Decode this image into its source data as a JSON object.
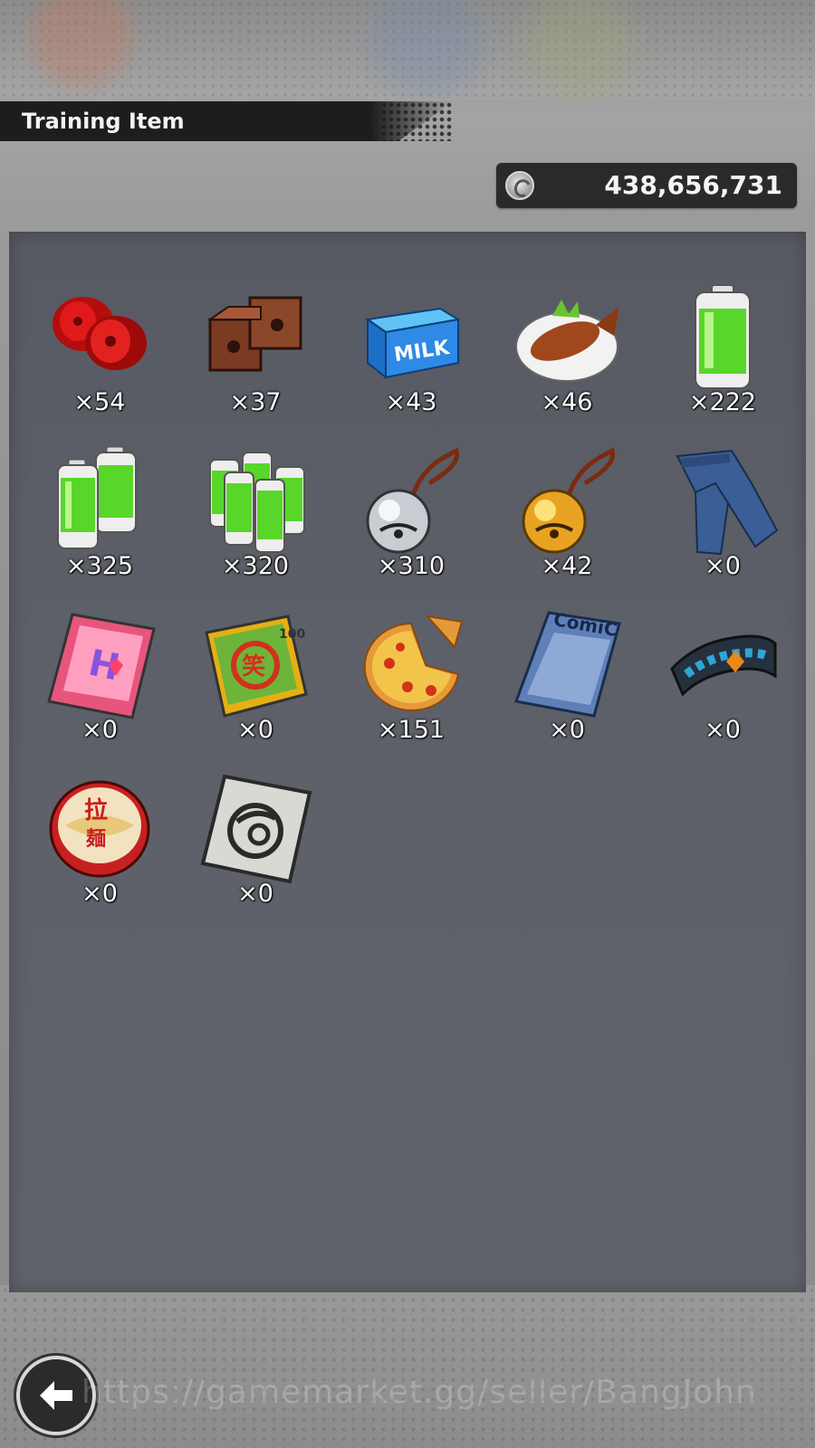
{
  "header": {
    "title": "Training Item"
  },
  "currency": {
    "icon": "zeni-coin-icon",
    "amount": "438,656,731"
  },
  "items": [
    {
      "icon": "red-weights-icon",
      "quantity": "×54"
    },
    {
      "icon": "bricks-icon",
      "quantity": "×37"
    },
    {
      "icon": "milk-carton-icon",
      "quantity": "×43"
    },
    {
      "icon": "grilled-fish-icon",
      "quantity": "×46"
    },
    {
      "icon": "battery-icon",
      "quantity": "×222"
    },
    {
      "icon": "battery-pair-icon",
      "quantity": "×325"
    },
    {
      "icon": "battery-pack-icon",
      "quantity": "×320"
    },
    {
      "icon": "silver-bell-icon",
      "quantity": "×310"
    },
    {
      "icon": "gold-bell-icon",
      "quantity": "×42"
    },
    {
      "icon": "jeans-icon",
      "quantity": "×0"
    },
    {
      "icon": "magazine-icon",
      "quantity": "×0"
    },
    {
      "icon": "joke-book-icon",
      "quantity": "×0"
    },
    {
      "icon": "pizza-icon",
      "quantity": "×151"
    },
    {
      "icon": "comic-book-icon",
      "quantity": "×0"
    },
    {
      "icon": "wristband-icon",
      "quantity": "×0"
    },
    {
      "icon": "cup-ramen-icon",
      "quantity": "×0"
    },
    {
      "icon": "capsule-card-icon",
      "quantity": "×0"
    }
  ],
  "footer": {
    "back_icon": "back-arrow-icon",
    "watermark": "https://gamemarket.gg/seller/BangJohn"
  }
}
